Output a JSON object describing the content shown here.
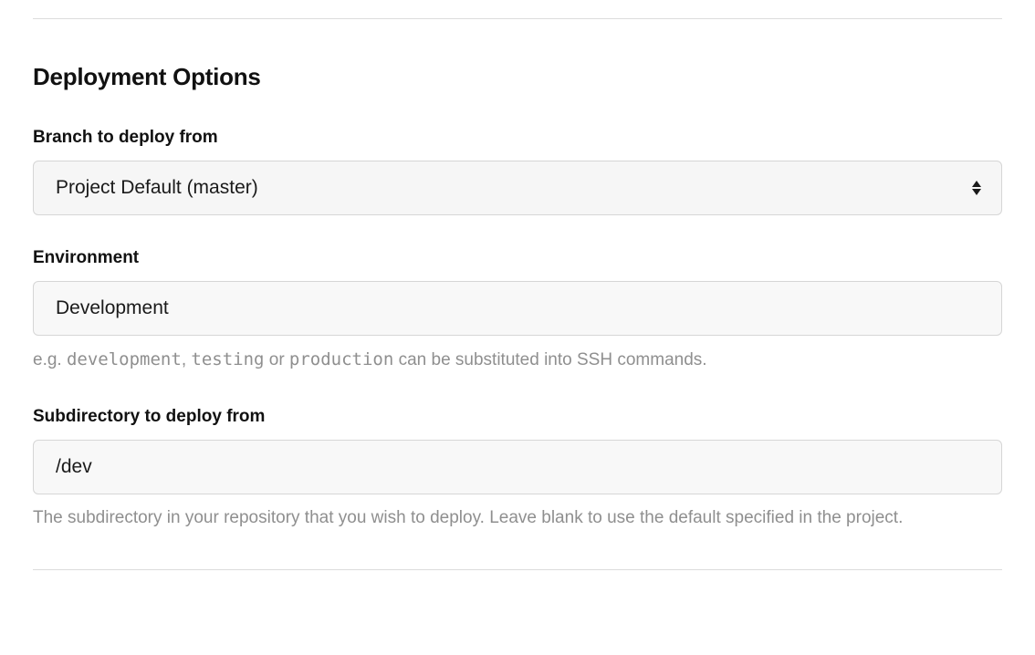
{
  "section": {
    "title": "Deployment Options"
  },
  "branch": {
    "label": "Branch to deploy from",
    "selected": "Project Default (master)"
  },
  "environment": {
    "label": "Environment",
    "value": "Development",
    "help_prefix": "e.g. ",
    "help_code1": "development",
    "help_sep1": ", ",
    "help_code2": "testing",
    "help_sep2": " or ",
    "help_code3": "production",
    "help_suffix": " can be substituted into SSH commands."
  },
  "subdirectory": {
    "label": "Subdirectory to deploy from",
    "value": "/dev",
    "help": "The subdirectory in your repository that you wish to deploy. Leave blank to use the default specified in the project."
  }
}
